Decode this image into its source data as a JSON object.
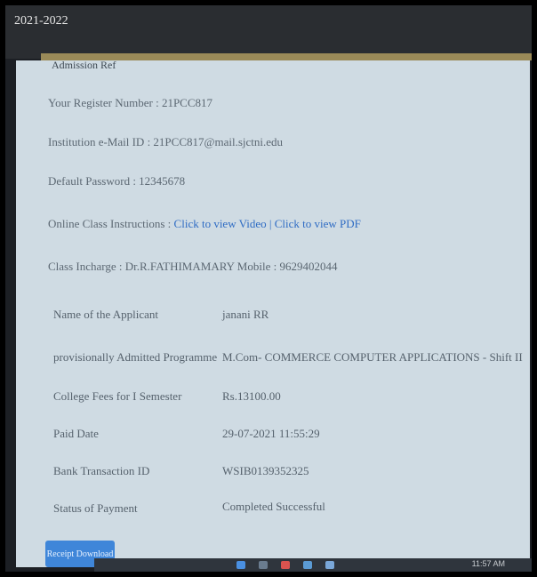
{
  "window": {
    "year": "2021-2022"
  },
  "top_cut": "Admission Ref",
  "lines": {
    "register": "Your Register Number : 21PCC817",
    "email": "Institution e-Mail ID : 21PCC817@mail.sjctni.edu",
    "password": "Default Password : 12345678",
    "instructions_label": "Online Class Instructions :",
    "link_video": "Click to view Video",
    "link_sep": " | ",
    "link_pdf": "Click to view PDF",
    "incharge": "Class Incharge : Dr.R.FATHIMAMARY Mobile : 9629402044"
  },
  "details": [
    {
      "label": "Name of the Applicant",
      "value": "janani RR"
    },
    {
      "label": "provisionally Admitted Programme",
      "value": "M.Com- COMMERCE COMPUTER APPLICATIONS - Shift II"
    },
    {
      "label": "College Fees for I Semester",
      "value": "Rs.13100.00"
    },
    {
      "label": "Paid Date",
      "value": "29-07-2021 11:55:29"
    },
    {
      "label": "Bank Transaction ID",
      "value": "WSIB0139352325"
    },
    {
      "label": "Status of Payment",
      "value": "Completed Successful"
    }
  ],
  "download_button": "Receipt Download",
  "taskbar": {
    "time": "11:57 AM"
  },
  "colors": {
    "accent_link": "#2f6cc4",
    "button": "#3f86d9",
    "gold_band": "#9a8a58"
  }
}
